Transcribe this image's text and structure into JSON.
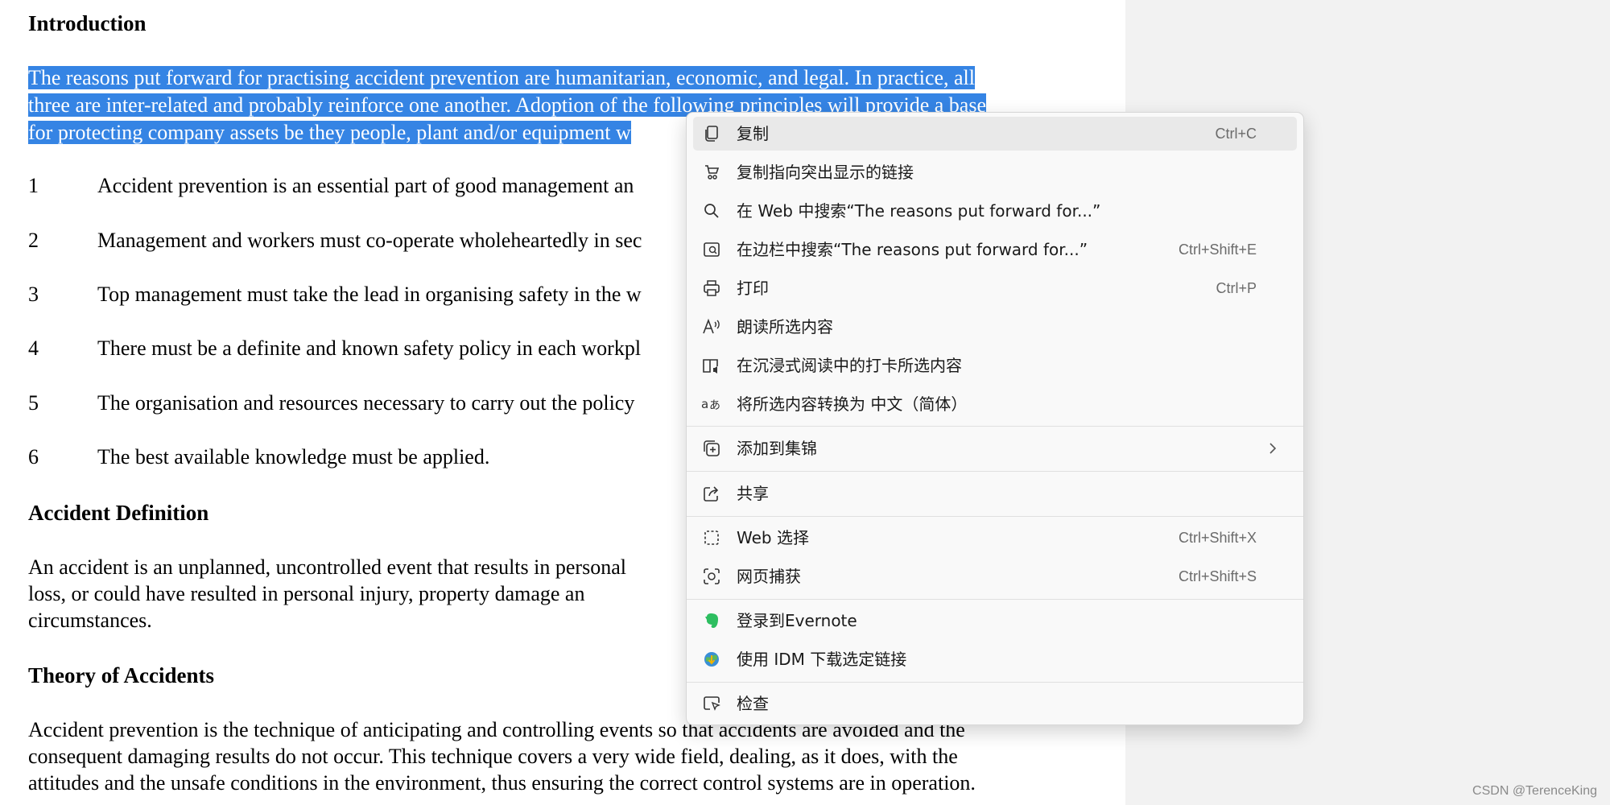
{
  "document": {
    "intro_heading": "Introduction",
    "selected_lines": [
      "The reasons put forward for practising accident prevention are humanitarian, economic, and legal. In practice, all",
      "three are inter-related and probably reinforce one another.  Adoption of the following principles will provide a base",
      "for protecting company assets be they people, plant and/or equipment w"
    ],
    "list": [
      {
        "num": "1",
        "text": "Accident prevention is an essential part of good management an"
      },
      {
        "num": "2",
        "text": "Management and workers must co-operate wholeheartedly in sec"
      },
      {
        "num": "3",
        "text": "Top management must take the lead in organising safety in the w"
      },
      {
        "num": "4",
        "text": "There must be a definite and known safety policy in each workpl"
      },
      {
        "num": "5",
        "text": "The organisation and resources necessary to carry out the policy"
      },
      {
        "num": "6",
        "text": "The best available knowledge must be applied."
      }
    ],
    "accident_def_heading": "Accident Definition",
    "accident_def_lines": [
      "An accident is an unplanned, uncontrolled event that results in personal",
      "loss, or could have resulted in personal injury, property damage an",
      "circumstances."
    ],
    "theory_heading": "Theory of Accidents",
    "theory_lines": [
      "Accident prevention is the technique of anticipating and controlling events so that accidents are avoided and the",
      "consequent damaging results do not occur.  This technique covers a very wide field, dealing, as it does, with the",
      "attitudes and the unsafe conditions in the environment, thus ensuring the correct control systems are in operation."
    ]
  },
  "context_menu": {
    "items": [
      {
        "label": "复制",
        "shortcut": "Ctrl+C",
        "icon": "copy-icon"
      },
      {
        "label": "复制指向突出显示的链接",
        "shortcut": "",
        "icon": "link-highlight-icon"
      },
      {
        "label": "在 Web 中搜索“The reasons put forward for...”",
        "shortcut": "",
        "icon": "search-icon"
      },
      {
        "label": "在边栏中搜索“The reasons put forward for...”",
        "shortcut": "Ctrl+Shift+E",
        "icon": "sidebar-search-icon"
      },
      {
        "label": "打印",
        "shortcut": "Ctrl+P",
        "icon": "printer-icon"
      },
      {
        "label": "朗读所选内容",
        "shortcut": "",
        "icon": "read-aloud-icon"
      },
      {
        "label": "在沉浸式阅读中的打卡所选内容",
        "shortcut": "",
        "icon": "immersive-reader-icon"
      },
      {
        "label": "将所选内容转换为 中文（简体）",
        "shortcut": "",
        "icon": "translate-icon"
      },
      {
        "label": "添加到集锦",
        "shortcut": "",
        "icon": "collections-icon"
      },
      {
        "label": "共享",
        "shortcut": "",
        "icon": "share-icon"
      },
      {
        "label": "Web 选择",
        "shortcut": "Ctrl+Shift+X",
        "icon": "web-select-icon"
      },
      {
        "label": "网页捕获",
        "shortcut": "Ctrl+Shift+S",
        "icon": "web-capture-icon"
      },
      {
        "label": "登录到Evernote",
        "shortcut": "",
        "icon": "evernote-icon"
      },
      {
        "label": "使用 IDM 下载选定链接",
        "shortcut": "",
        "icon": "idm-icon"
      },
      {
        "label": "检查",
        "shortcut": "",
        "icon": "inspect-icon"
      }
    ],
    "colors": {
      "selection": "#3584e4",
      "evernote": "#2dbe60",
      "hover": "#e9e9e9"
    }
  },
  "watermark": "CSDN @TerenceKing"
}
